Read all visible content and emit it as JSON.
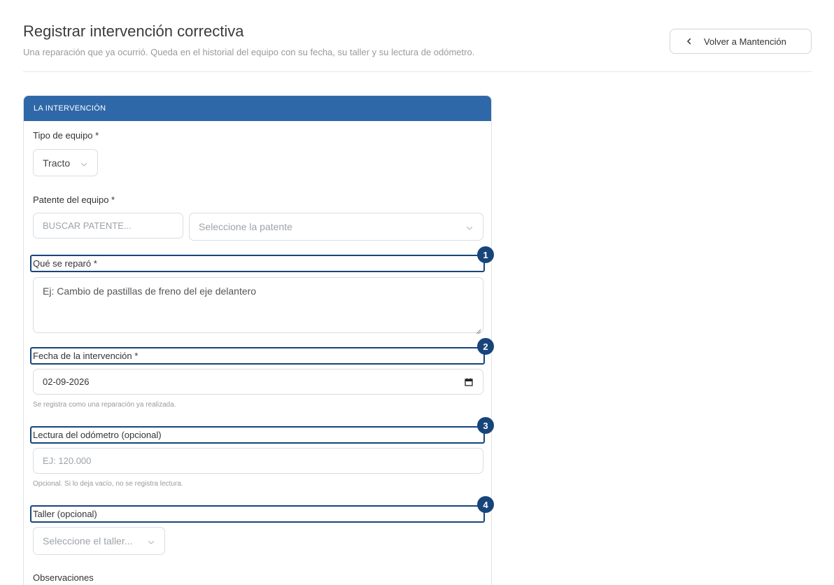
{
  "header": {
    "title": "Registrar intervención correctiva",
    "subtitle": "Una reparación que ya ocurrió. Queda en el historial del equipo con su fecha, su taller y su lectura de odómetro.",
    "back_label": "Volver a Mantención"
  },
  "card": {
    "title": "LA INTERVENCIÓN"
  },
  "fields": {
    "tipo_equipo": {
      "label": "Tipo de equipo *",
      "value": "Tracto"
    },
    "patente": {
      "label": "Patente del equipo *",
      "search_placeholder": "BUSCAR PATENTE...",
      "select_placeholder": "Seleccione la patente"
    },
    "que_se_reparo": {
      "label": "Qué se reparó *",
      "placeholder": "Ej: Cambio de pastillas de freno del eje delantero"
    },
    "fecha": {
      "label": "Fecha de la intervención *",
      "value": "02-09-2026",
      "help": "Se registra como una reparación ya realizada."
    },
    "odometro": {
      "label": "Lectura del odómetro (opcional)",
      "placeholder": "EJ: 120.000",
      "help": "Opcional. Si lo deja vacío, no se registra lectura."
    },
    "taller": {
      "label": "Taller (opcional)",
      "placeholder": "Seleccione el taller..."
    },
    "observaciones": {
      "label": "Observaciones"
    }
  },
  "markers": [
    "1",
    "2",
    "3",
    "4"
  ],
  "colors": {
    "card_header": "#2f68a8",
    "highlight": "#17457a"
  }
}
